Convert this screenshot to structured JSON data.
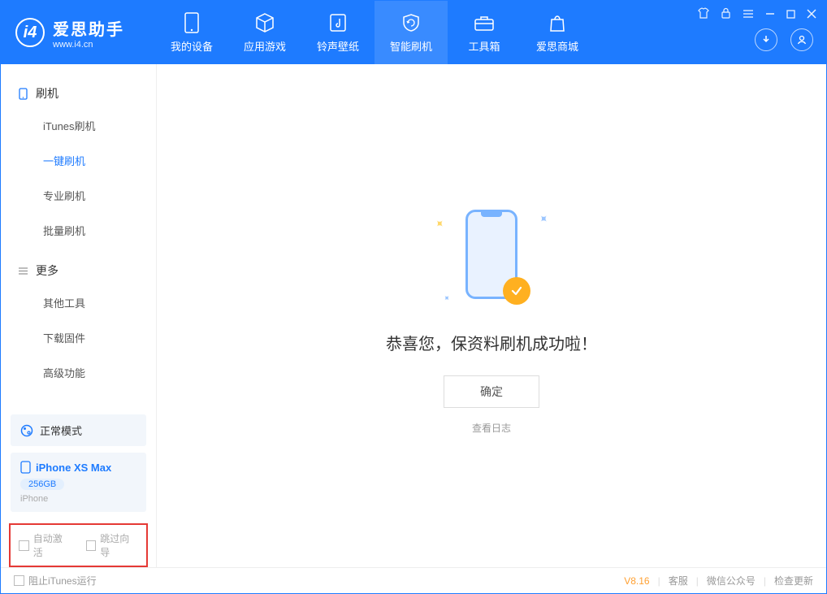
{
  "app": {
    "title": "爱思助手",
    "subtitle": "www.i4.cn"
  },
  "nav": {
    "items": [
      {
        "label": "我的设备"
      },
      {
        "label": "应用游戏"
      },
      {
        "label": "铃声壁纸"
      },
      {
        "label": "智能刷机"
      },
      {
        "label": "工具箱"
      },
      {
        "label": "爱思商城"
      }
    ]
  },
  "sidebar": {
    "group1_title": "刷机",
    "group1_items": [
      "iTunes刷机",
      "一键刷机",
      "专业刷机",
      "批量刷机"
    ],
    "group2_title": "更多",
    "group2_items": [
      "其他工具",
      "下载固件",
      "高级功能"
    ]
  },
  "device": {
    "mode": "正常模式",
    "name": "iPhone XS Max",
    "capacity": "256GB",
    "type": "iPhone"
  },
  "options": {
    "auto_activate": "自动激活",
    "skip_guide": "跳过向导"
  },
  "main": {
    "success_message": "恭喜您，保资料刷机成功啦！",
    "ok_label": "确定",
    "view_log": "查看日志"
  },
  "footer": {
    "block_itunes": "阻止iTunes运行",
    "version": "V8.16",
    "support": "客服",
    "wechat": "微信公众号",
    "check_update": "检查更新"
  }
}
